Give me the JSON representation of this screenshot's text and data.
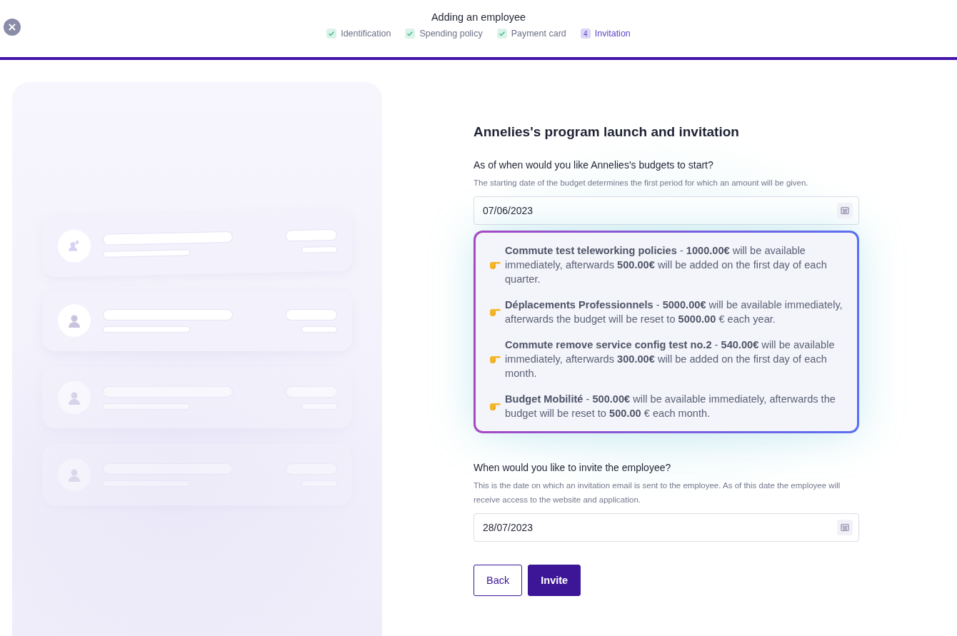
{
  "header": {
    "close_label": "×",
    "title": "Adding an employee",
    "steps": [
      {
        "label": "Identification",
        "completed": true,
        "selected": false
      },
      {
        "label": "Spending policy",
        "completed": true,
        "selected": false
      },
      {
        "label": "Payment card",
        "completed": true,
        "selected": false
      },
      {
        "label": "Invitation",
        "completed": false,
        "selected": true,
        "number": "4"
      }
    ]
  },
  "form": {
    "title": "Annelies's program launch and invitation",
    "start": {
      "question": "As of when would you like Annelies's budgets to start?",
      "hint": "The starting date of the budget determines the first period for which an amount will be given.",
      "value": "07/06/2023"
    },
    "budgets": [
      "**Commute test teleworking policies** - **1000.00€** will be available immediately, afterwards **500.00€** will be added on the first day of each quarter.",
      "**Déplacements Professionnels** - **5000.00€** will be available immediately, afterwards the budget will be reset to **5000.00** € each year.",
      "**Commute remove service config test no.2** - **540.00€** will be available immediately, afterwards **300.00€** will be added on the first day of each month.",
      "**Budget Mobilité** - **500.00€** will be available immediately, afterwards the budget will be reset to **500.00** € each month."
    ],
    "invite": {
      "question": "When would you like to invite the employee?",
      "hint": "This is the date on which an invitation email is sent to the employee. As of this date the employee will receive access to the website and application.",
      "value": "28/07/2023"
    },
    "buttons": [
      {
        "label": "Back",
        "kind": "secondary"
      },
      {
        "label": "Invite",
        "kind": "primary"
      }
    ]
  }
}
